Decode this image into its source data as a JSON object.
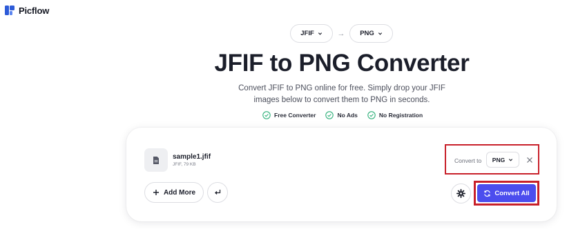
{
  "brand": {
    "name": "Picflow"
  },
  "formats": {
    "from": "JFIF",
    "to": "PNG",
    "arrow": "→"
  },
  "hero": {
    "title": "JFIF to PNG Converter",
    "subtitle": "Convert JFIF to PNG online for free. Simply drop your JFIF images below to convert them to PNG in seconds."
  },
  "features": [
    "Free Converter",
    "No Ads",
    "No Registration"
  ],
  "file": {
    "name": "sample1.jfif",
    "meta": "JFIF, 79 KB"
  },
  "convert": {
    "label": "Convert to",
    "value": "PNG"
  },
  "actions": {
    "add_more": "Add More",
    "convert_all": "Convert All"
  },
  "colors": {
    "accent": "#4b4dee",
    "highlight": "#c8202a",
    "check": "#2fb07a"
  }
}
